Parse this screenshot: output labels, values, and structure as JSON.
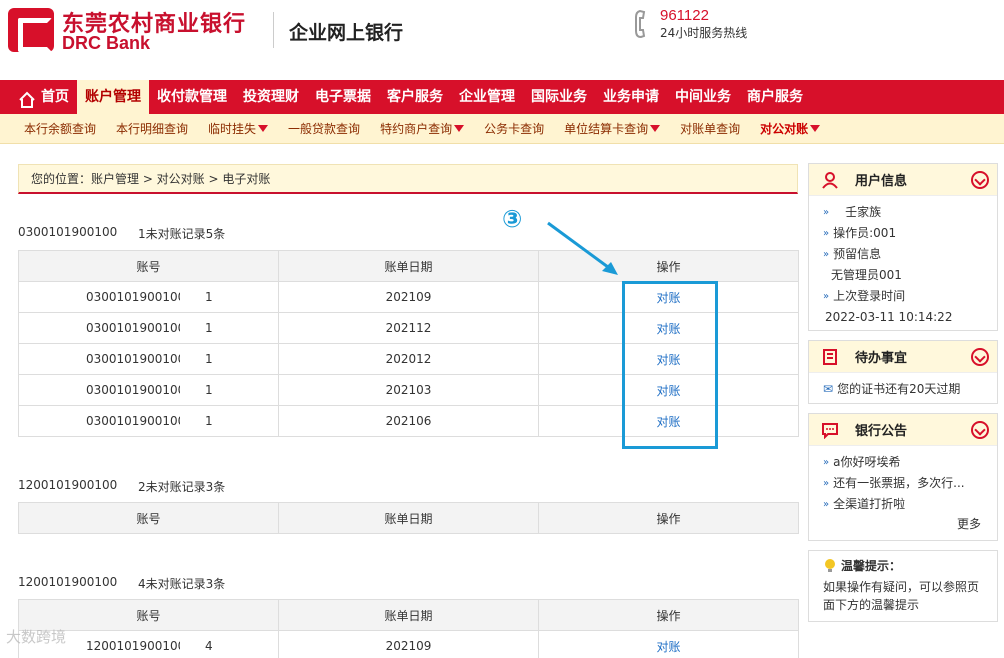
{
  "header": {
    "bank_name_cn": "东莞农村商业银行",
    "bank_name_en": "DRC Bank",
    "subtitle": "企业网上银行",
    "hotline_number": "961122",
    "hotline_text": "24小时服务热线"
  },
  "main_nav": [
    "首页",
    "账户管理",
    "收付款管理",
    "投资理财",
    "电子票据",
    "客户服务",
    "企业管理",
    "国际业务",
    "业务申请",
    "中间业务",
    "商户服务"
  ],
  "sub_nav": [
    {
      "label": "本行余额查询",
      "dropdown": false
    },
    {
      "label": "本行明细查询",
      "dropdown": false
    },
    {
      "label": "临时挂失",
      "dropdown": true
    },
    {
      "label": "一般贷款查询",
      "dropdown": false
    },
    {
      "label": "特约商户查询",
      "dropdown": true
    },
    {
      "label": "公务卡查询",
      "dropdown": false
    },
    {
      "label": "单位结算卡查询",
      "dropdown": true
    },
    {
      "label": "对账单查询",
      "dropdown": false
    },
    {
      "label": "对公对账",
      "dropdown": true
    }
  ],
  "breadcrumb": "您的位置：账户管理 > 对公对账 > 电子对账",
  "table_headers": {
    "account": "账号",
    "date": "账单日期",
    "action": "操作"
  },
  "groups": [
    {
      "account": "0300101900100",
      "summary": "1未对账记录5条",
      "rows": [
        {
          "account": "0300101900100",
          "count": "1",
          "date": "202109",
          "action": "对账"
        },
        {
          "account": "0300101900100",
          "count": "1",
          "date": "202112",
          "action": "对账"
        },
        {
          "account": "0300101900100",
          "count": "1",
          "date": "202012",
          "action": "对账"
        },
        {
          "account": "0300101900100",
          "count": "1",
          "date": "202103",
          "action": "对账"
        },
        {
          "account": "0300101900100",
          "count": "1",
          "date": "202106",
          "action": "对账"
        }
      ]
    },
    {
      "account": "1200101900100",
      "summary": "2未对账记录3条",
      "rows": []
    },
    {
      "account": "1200101900100",
      "summary": "4未对账记录3条",
      "rows": [
        {
          "account": "1200101900100",
          "count": "4",
          "date": "202109",
          "action": "对账"
        }
      ]
    }
  ],
  "annotation": {
    "marker": "③",
    "color": "#1a9ad6"
  },
  "user_panel": {
    "title": "用户信息",
    "name": "壬家族",
    "operator": "操作员:001",
    "reserved_label": "预留信息",
    "reserved_value": "无管理员001",
    "last_login_label": "上次登录时间",
    "last_login_time": "2022-03-11 10:14:22"
  },
  "todo_panel": {
    "title": "待办事宜",
    "item": "您的证书还有20天过期"
  },
  "notice_panel": {
    "title": "银行公告",
    "items": [
      "a你好呀埃希",
      "还有一张票据，多次行...",
      "全渠道打折啦"
    ],
    "more": "更多"
  },
  "tip": {
    "title": "温馨提示：",
    "text": "如果操作有疑问，可以参照页面下方的温馨提示"
  },
  "watermark": "大数跨境",
  "colors": {
    "brand_red": "#d7102a",
    "subnav_bg": "#fff4d1",
    "link_blue": "#1e6ec5",
    "annotation_blue": "#1a9ad6"
  }
}
